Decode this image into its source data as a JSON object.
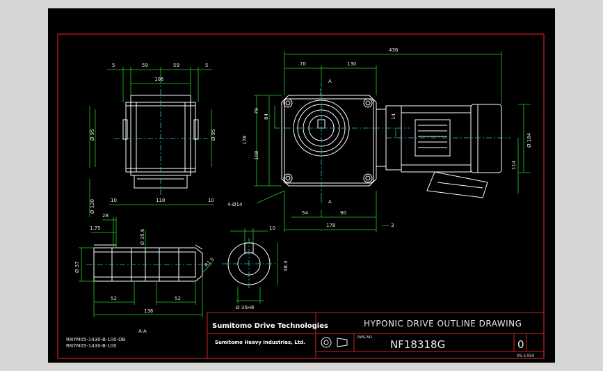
{
  "title_block": {
    "company": "Sumitomo Drive Technologies",
    "company_sub": "Sumitomo Heavy Industries, Ltd.",
    "title": "HYPONIC DRIVE OUTLINE DRAWING",
    "drawing_number": "NF18318G",
    "revision": "0",
    "sheet_code": "05-1434",
    "dwg_label": "DWG.NO."
  },
  "notes": {
    "model_line_1": "RNYM05-1430-B-100-DB",
    "model_line_2": "RNYM05-1430-B-100",
    "section_label": "A-A"
  },
  "dims": {
    "overall_length": "436",
    "d70": "70",
    "d130": "130",
    "section_top": "A",
    "section_bottom": "A",
    "d5_left": "5",
    "d59_left": "59",
    "d59_right": "59",
    "d5_right": "5",
    "d106": "106",
    "d95_left": "Ø 95",
    "d95_right": "Ø 95",
    "d120": "Ø 120",
    "d10_left": "10",
    "d118": "118",
    "d10_right": "10",
    "d79": "79",
    "d178_vert": "178",
    "d84": "84",
    "d108": "108",
    "d14_small": "14",
    "d184": "Ø 184",
    "d114": "114",
    "holes": "4-Ø14",
    "d54": "54",
    "d90": "90",
    "d178_horiz": "178",
    "d3": "3",
    "d28": "28",
    "d175": "1.75",
    "d356": "Ø 35.6",
    "d37": "Ø 37",
    "r15": "R1.5",
    "d52_left": "52",
    "d52_right": "52",
    "d136": "136",
    "d10_key": "10",
    "d383": "38.3",
    "d35h8": "Ø 35H8"
  },
  "colors": {
    "frame": "#d42020",
    "geometry": "#ffffff",
    "dimension": "#1fd21f",
    "centerline": "#26c6da",
    "text": "#e8e8e8"
  }
}
